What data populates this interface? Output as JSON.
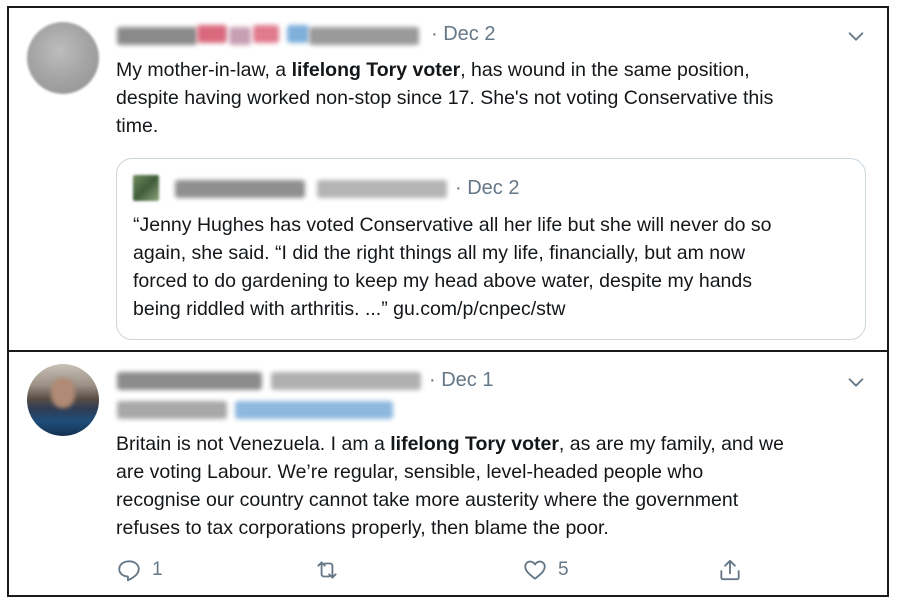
{
  "tweets": [
    {
      "date": "· Dec 2",
      "text": {
        "line1_pre": "My mother-in-law, a ",
        "line1_bold": "lifelong Tory voter",
        "line1_post": ", has wound in the same position,",
        "line2": "despite having worked non-stop since 17. She's not voting Conservative this",
        "line3": "time."
      },
      "quoted": {
        "date": "· Dec 2",
        "lines": [
          "“Jenny Hughes has voted Conservative all her life but she will never do so",
          "again, she said. “I did the right things all my life, financially, but am now",
          "forced to do gardening to keep my head above water, despite my hands",
          "being riddled with arthritis. ...” gu.com/p/cnpec/stw"
        ]
      }
    },
    {
      "date": "· Dec 1",
      "text": {
        "line1_pre": "Britain is not Venezuela. I am a ",
        "line1_bold": "lifelong Tory voter",
        "line1_post": ", as are my family, and we",
        "line2": "are voting Labour. We’re regular, sensible, level-headed people who",
        "line3": "recognise our country cannot take more austerity where the government",
        "line4": "refuses to tax corporations properly, then blame the poor."
      },
      "actions": {
        "reply_count": "1",
        "retweet_count": "",
        "like_count": "5"
      }
    }
  ],
  "icons": {
    "more": "chevron-down-icon",
    "reply": "reply-icon",
    "retweet": "retweet-icon",
    "like": "heart-icon",
    "share": "share-icon"
  },
  "colors": {
    "secondary_text": "#657786",
    "border": "#ccd6dd",
    "frame": "#1a1a1a"
  }
}
